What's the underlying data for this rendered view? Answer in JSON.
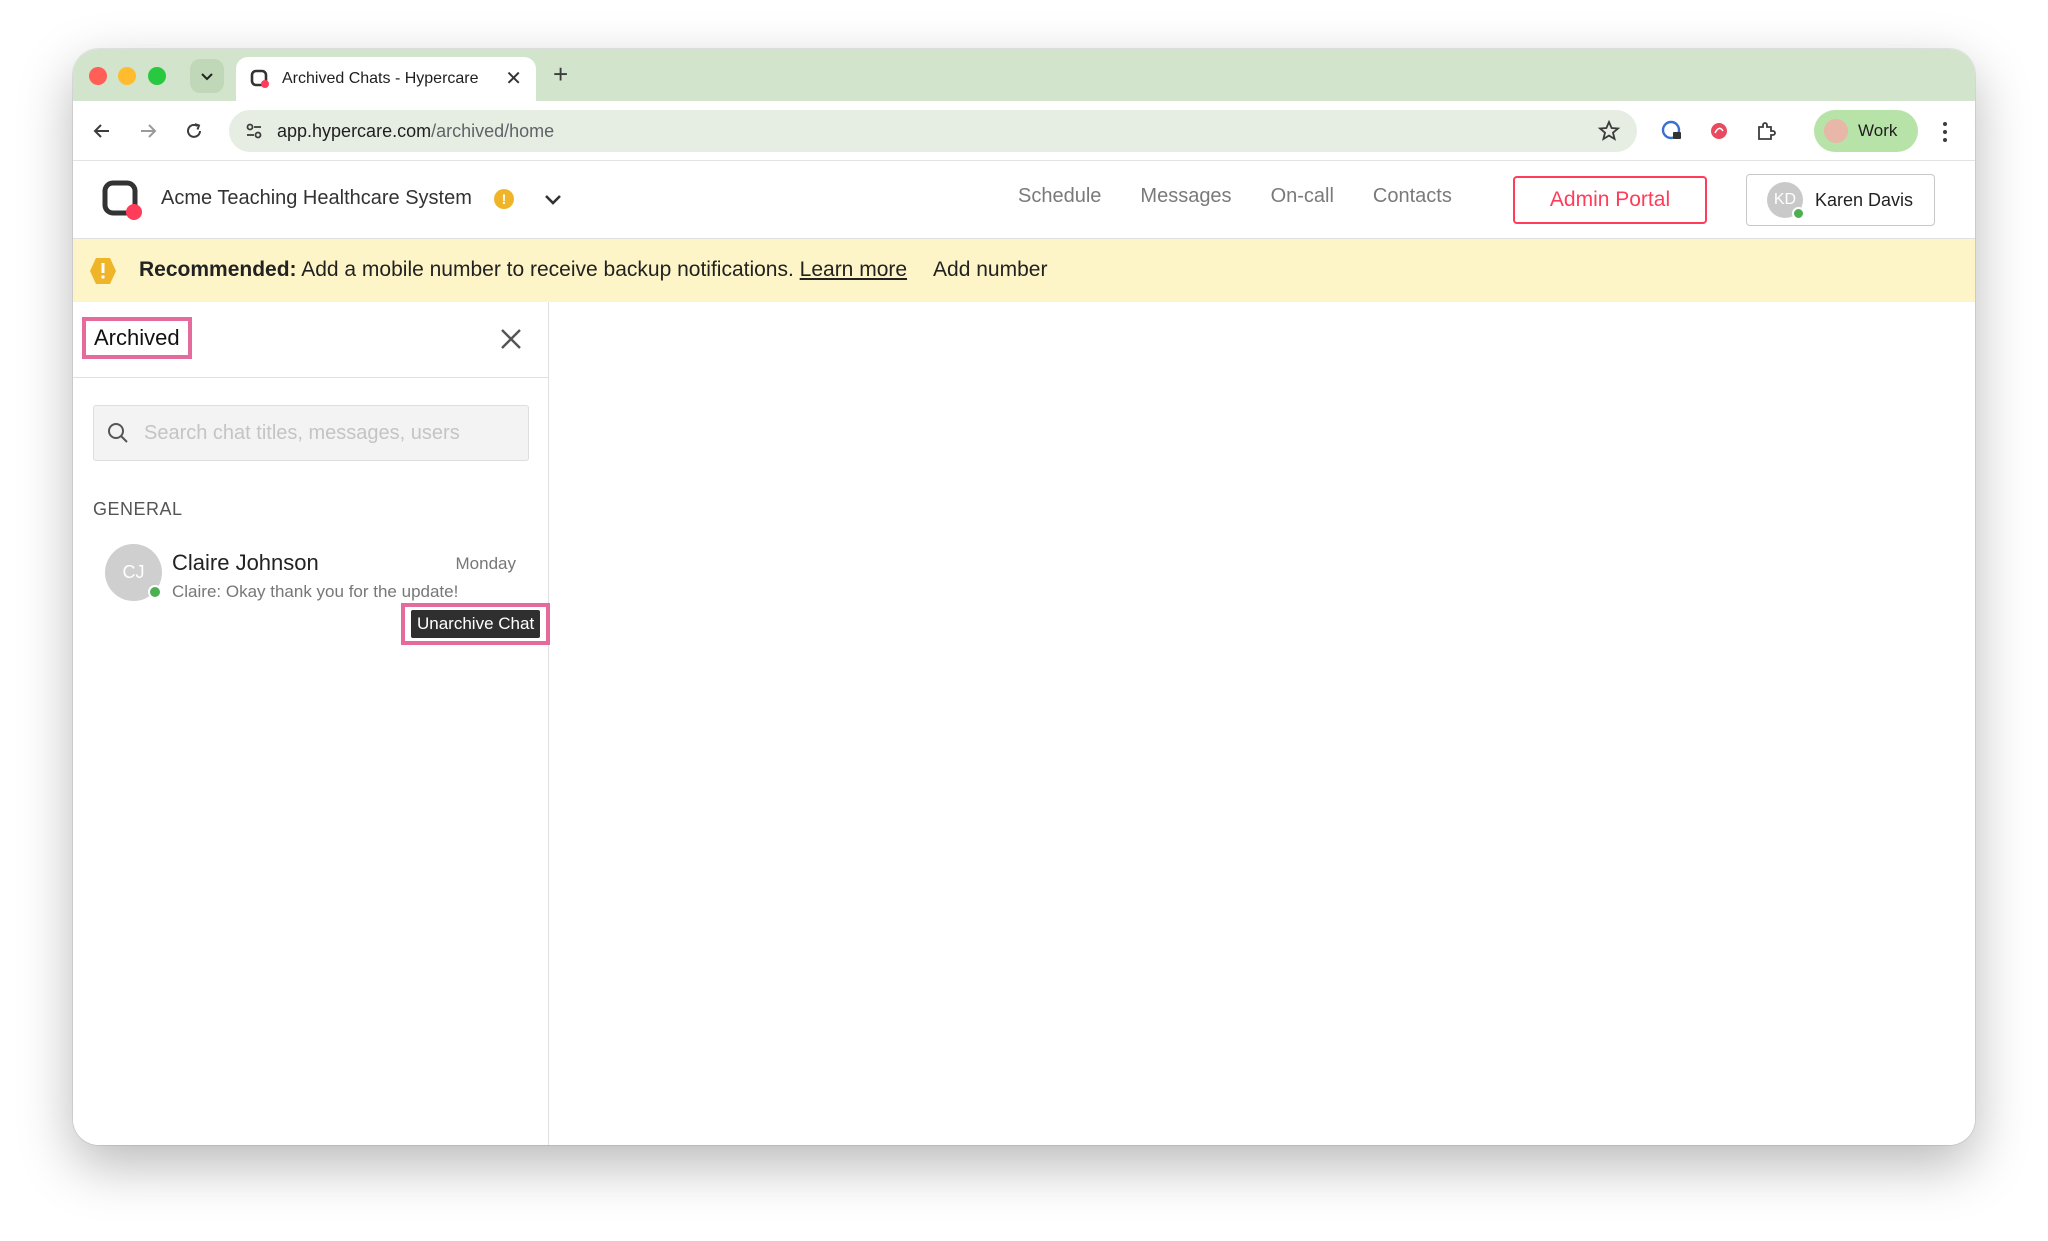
{
  "browser": {
    "tab_title": "Archived Chats - Hypercare",
    "tab_close": "✕",
    "new_tab": "+",
    "url_host": "app.hypercare.com",
    "url_path": "/archived/home",
    "profile_label": "Work"
  },
  "header": {
    "org_name": "Acme Teaching Healthcare System",
    "org_warning": "!",
    "nav": [
      "Schedule",
      "Messages",
      "On-call",
      "Contacts"
    ],
    "admin_button": "Admin Portal",
    "user_initials": "KD",
    "user_name": "Karen Davis"
  },
  "banner": {
    "bold": "Recommended:",
    "text": " Add a mobile number to receive backup notifications. ",
    "link": "Learn more",
    "action": "Add number"
  },
  "sidebar": {
    "title": "Archived",
    "search_placeholder": "Search chat titles, messages, users",
    "section": "GENERAL",
    "chats": [
      {
        "initials": "CJ",
        "name": "Claire Johnson",
        "time": "Monday",
        "preview": "Claire: Okay thank you for the update!"
      }
    ],
    "tooltip": "Unarchive Chat"
  },
  "colors": {
    "accent": "#ff3c5a",
    "highlight": "#e46b9b",
    "banner_bg": "#fdf5c7",
    "online": "#4caf50",
    "browser_chrome": "#d3e4cd"
  }
}
